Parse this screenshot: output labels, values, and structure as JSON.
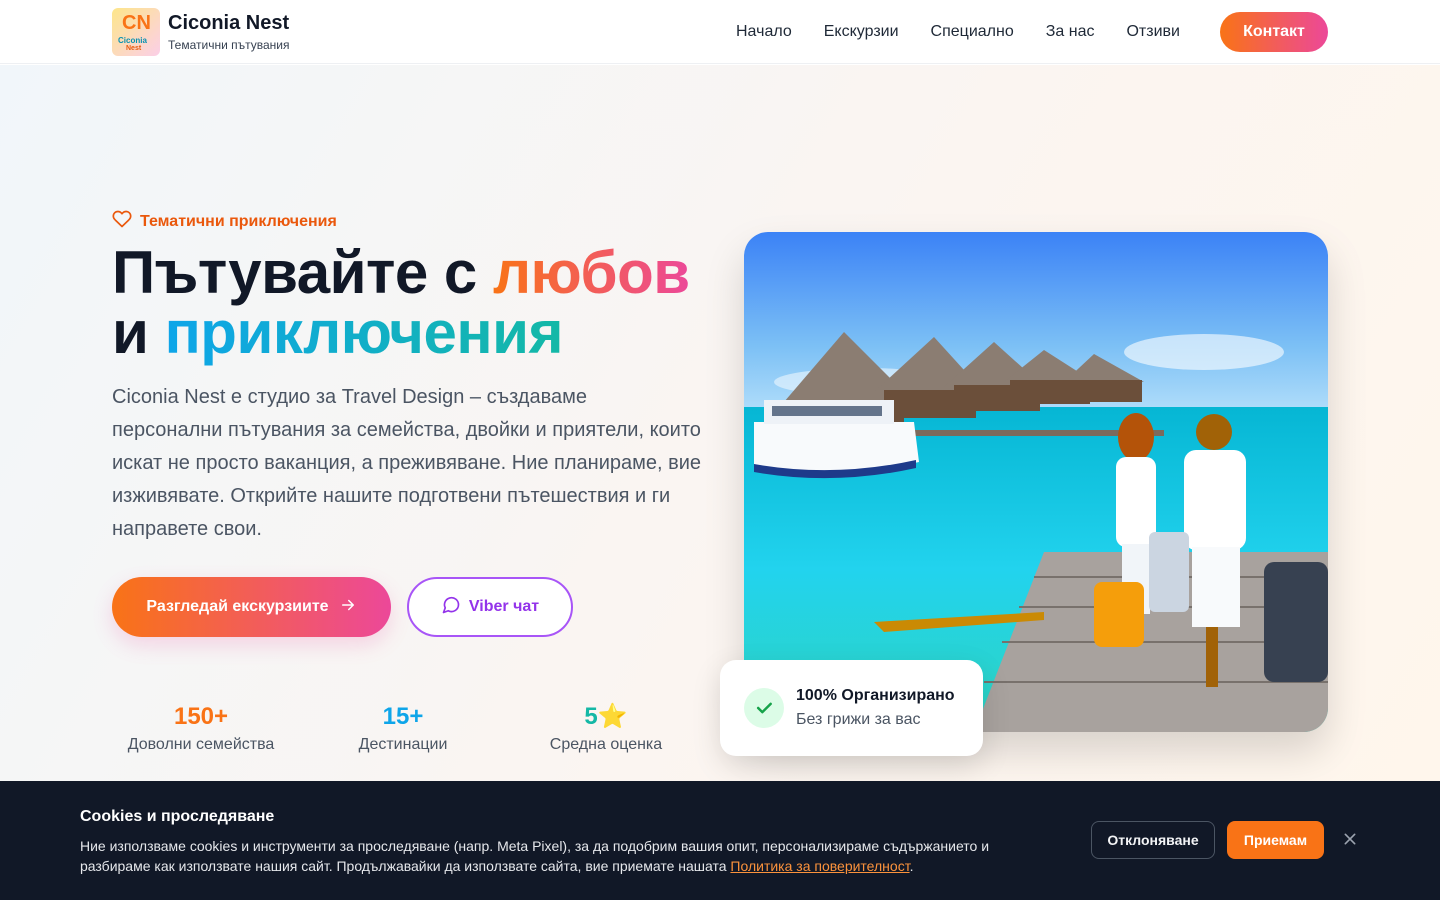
{
  "header": {
    "brand_name": "Ciconia Nest",
    "brand_tagline": "Тематични пътувания",
    "logo_text": "Ciconia Nest",
    "nav": [
      "Начало",
      "Екскурзии",
      "Специално",
      "За нас",
      "Отзиви"
    ],
    "contact_label": "Контакт"
  },
  "hero": {
    "eyebrow": "Тематични приключения",
    "headline_part1": "Пътувайте с ",
    "headline_accent1": "любов",
    "headline_part2": "и ",
    "headline_accent2": "приключения",
    "lead": "Ciconia Nest е студио за Travel Design – създаваме персонални пътувания за семейства, двойки и приятели, които искат не просто ваканция, а преживяване. Ние планираме, вие изживявате. Открийте нашите подготвени пътешествия и ги направете свои.",
    "primary_button": "Разгледай екскурзиите",
    "viber_button": "Viber чат",
    "stats": [
      {
        "value": "150+",
        "label": "Доволни семейства",
        "color": "#f97316"
      },
      {
        "value": "15+",
        "label": "Дестинации",
        "color": "#0ea5e9"
      },
      {
        "value": "5⭐",
        "label": "Средна оценка",
        "color": "#14b8a6"
      }
    ],
    "badge_title": "100% Организирано",
    "badge_subtitle": "Без грижи за вас"
  },
  "cookie": {
    "title": "Cookies и проследяване",
    "text": "Ние използваме cookies и инструменти за проследяване (напр. Meta Pixel), за да подобрим вашия опит, персонализираме съдържанието и разбираме как използвате нашия сайт. Продължавайки да използвате сайта, вие приемате нашата ",
    "link": "Политика за поверителност",
    "text_end": ".",
    "decline_label": "Отклоняване",
    "accept_label": "Приемам"
  },
  "colors": {
    "accent_orange": "#f97316",
    "accent_pink": "#ec4899",
    "accent_blue": "#0ea5e9",
    "accent_purple": "#a855f7"
  }
}
